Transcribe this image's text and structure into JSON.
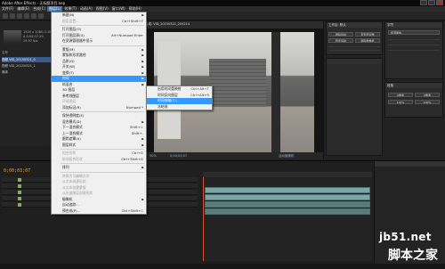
{
  "window": {
    "title": "Adobe After Effects - 无标题项目.aep"
  },
  "menubar": [
    "文件(F)",
    "编辑(E)",
    "合成(C)",
    "图层(L)",
    "效果(T)",
    "动画(A)",
    "视图(V)",
    "窗口(W)",
    "帮助(H)"
  ],
  "project": {
    "info": [
      "1920 x 1080 (1.00)",
      "Δ 0;00;07;29, 29.97 fps"
    ],
    "header": "名称",
    "items": [
      "视频 VID_20150321_0",
      "视频 VID_20150321_1",
      "媒体"
    ]
  },
  "viewer": {
    "tab": "合成: VID_20150321_204214",
    "zoom": "50%",
    "timecode": "0;00;03;07",
    "view_label": "活动摄像机"
  },
  "right_panel": {
    "top_title": "工作区: 默认",
    "controls": [
      "跟踪运动",
      "变形稳定器",
      "稳定运动",
      "跟踪摄像机"
    ],
    "info_title": "字符",
    "font": "思源黑体",
    "para_title": "段落",
    "values": [
      "0像素",
      "0像素",
      "100%",
      "100%"
    ]
  },
  "timeline": {
    "timecode": "0;00;03;07",
    "layers": [
      "1",
      "2",
      "3",
      "4",
      "5"
    ]
  },
  "main_menu": [
    {
      "label": "新建(N)",
      "arrow": true
    },
    {
      "label": "图层设置...",
      "shortcut": "Ctrl+Shift+Y",
      "disabled": true
    },
    {
      "sep": true
    },
    {
      "label": "打开图层(O)"
    },
    {
      "label": "打开图层源(U)",
      "shortcut": "Alt+Numpad Enter"
    },
    {
      "label": "在资源管理器中显示"
    },
    {
      "sep": true
    },
    {
      "label": "蒙版(M)",
      "arrow": true
    },
    {
      "label": "蒙版和形状路径",
      "arrow": true
    },
    {
      "label": "品质(Q)",
      "arrow": true
    },
    {
      "label": "开关(W)",
      "arrow": true
    },
    {
      "label": "变换(T)",
      "arrow": true
    },
    {
      "label": "时间",
      "arrow": true,
      "highlight": true
    },
    {
      "label": "帧混合",
      "arrow": true
    },
    {
      "label": "3D 图层"
    },
    {
      "label": "参考线图层"
    },
    {
      "label": "环境图层",
      "disabled": true
    },
    {
      "label": "添加标记(R)",
      "shortcut": "Numpad *"
    },
    {
      "sep": true
    },
    {
      "label": "保持透明度(E)"
    },
    {
      "label": "混合模式(D)",
      "arrow": true
    },
    {
      "label": "下一混合模式",
      "shortcut": "Shift+="
    },
    {
      "label": "上一混合模式",
      "shortcut": "Shift+-"
    },
    {
      "label": "跟踪遮罩(A)",
      "arrow": true
    },
    {
      "label": "图层样式",
      "arrow": true
    },
    {
      "sep": true
    },
    {
      "label": "组合形状",
      "shortcut": "Ctrl+G",
      "disabled": true
    },
    {
      "label": "取消组合形状",
      "shortcut": "Ctrl+Shift+G",
      "disabled": true
    },
    {
      "sep": true
    },
    {
      "label": "排列",
      "arrow": true
    },
    {
      "sep": true
    },
    {
      "label": "转换为可编辑文字",
      "disabled": true
    },
    {
      "label": "从文本创建形状",
      "disabled": true
    },
    {
      "label": "从文本创建蒙版",
      "disabled": true
    },
    {
      "label": "从矢量图层创建形状",
      "disabled": true
    },
    {
      "label": "摄像机",
      "arrow": true
    },
    {
      "label": "自动追踪..."
    },
    {
      "label": "预合成(P)...",
      "shortcut": "Ctrl+Shift+C"
    }
  ],
  "sub_menu": [
    {
      "label": "启用时间重映射",
      "shortcut": "Ctrl+Alt+T"
    },
    {
      "label": "时间反向图层",
      "shortcut": "Ctrl+Alt+R"
    },
    {
      "label": "时间伸缩(C)...",
      "highlight": true
    },
    {
      "label": "冻结帧"
    }
  ],
  "watermark": {
    "line1": "jb51.net",
    "line2": "脚本之家"
  }
}
